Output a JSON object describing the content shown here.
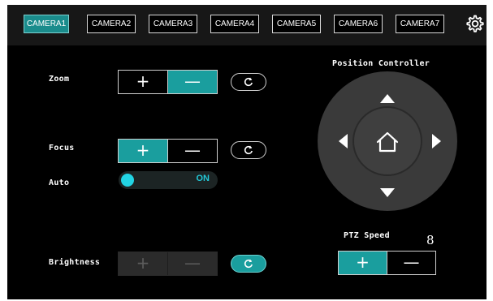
{
  "tabs": [
    {
      "label": "CAMERA1",
      "active": true
    },
    {
      "label": "CAMERA2",
      "active": false
    },
    {
      "label": "CAMERA3",
      "active": false
    },
    {
      "label": "CAMERA4",
      "active": false
    },
    {
      "label": "CAMERA5",
      "active": false
    },
    {
      "label": "CAMERA6",
      "active": false
    },
    {
      "label": "CAMERA7",
      "active": false
    }
  ],
  "settings_icon": "gear-icon",
  "zoom": {
    "label": "Zoom",
    "plus": "+",
    "minus": "—",
    "active": "minus",
    "reset_icon": "reset-icon"
  },
  "focus": {
    "label": "Focus",
    "plus": "+",
    "minus": "—",
    "active": "plus",
    "reset_icon": "reset-icon"
  },
  "auto": {
    "label": "Auto",
    "state": "ON"
  },
  "brightness": {
    "label": "Brightness",
    "plus": "+",
    "minus": "—",
    "disabled": true,
    "reset_icon": "reset-icon"
  },
  "position_controller": {
    "title": "Position Controller",
    "icons": [
      "up-arrow-icon",
      "down-arrow-icon",
      "left-arrow-icon",
      "right-arrow-icon",
      "home-icon"
    ]
  },
  "ptz_speed": {
    "label": "PTZ Speed",
    "value": "8",
    "plus": "+",
    "minus": "—",
    "active": "plus"
  },
  "colors": {
    "accent": "#1a9e9e",
    "toggle_knob": "#22d3e3",
    "background": "#000000"
  }
}
